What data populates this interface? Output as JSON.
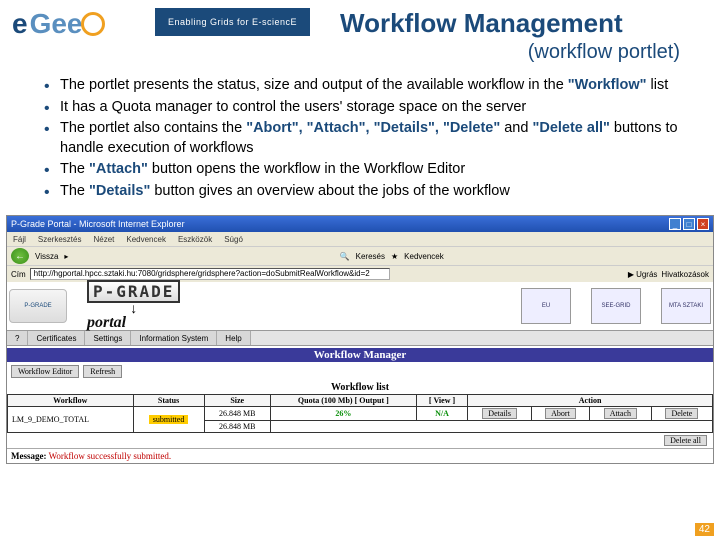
{
  "header": {
    "logo_text_e": "e",
    "logo_text_gee": "Gee",
    "tagline": "Enabling Grids for E-sciencE",
    "title": "Workflow Management",
    "subtitle": "(workflow portlet)"
  },
  "bullets": {
    "b1_pre": "The portlet presents the status, size and output of the available workflow in the ",
    "b1_wf": "\"Workflow\"",
    "b1_post": " list",
    "b2": "It has a Quota manager to control the users' storage space on the server",
    "b3_pre": "The portlet also contains the ",
    "b3_mid": "\"Abort\", \"Attach\", \"Details\", \"Delete\"",
    "b3_and": " and ",
    "b3_da": "\"Delete all\"",
    "b3_post": " buttons to handle execution of workflows",
    "b4_pre": "The ",
    "b4_att": "\"Attach\"",
    "b4_post": " button opens the workflow in the Workflow Editor",
    "b5_pre": "The ",
    "b5_det": "\"Details\"",
    "b5_post": " button gives an overview about the jobs of the workflow"
  },
  "ie": {
    "title": "P-Grade Portal - Microsoft Internet Explorer",
    "menu": {
      "m1": "Fájl",
      "m2": "Szerkesztés",
      "m3": "Nézet",
      "m4": "Kedvencek",
      "m5": "Eszközök",
      "m6": "Súgó"
    },
    "toolbar": {
      "back": "Vissza",
      "search": "Keresés",
      "fav": "Kedvencek"
    },
    "addr_label": "Cím",
    "address": "http://hgportal.hpcc.sztaki.hu:7080/gridsphere/gridsphere?action=doSubmitRealWorkflow&id=2",
    "go": "Ugrás",
    "links": "Hivatkozások"
  },
  "portal": {
    "pgrade_badge": "P-GRADE",
    "pgrade_text": "P-GRADE",
    "portal_word": "portal",
    "partner1": "EU",
    "partner2": "SEE-GRID",
    "partner3": "MTA SZTAKI",
    "tabs": {
      "t0": "?",
      "t1": "Certificates",
      "t2": "Settings",
      "t3": "Information System",
      "t4": "Help"
    }
  },
  "wm": {
    "banner": "Workflow Manager",
    "editor_btn": "Workflow Editor",
    "refresh_btn": "Refresh",
    "list_title": "Workflow list",
    "cols": {
      "c1": "Workflow",
      "c2": "Status",
      "c3": "Size",
      "c4": "Quota (100 Mb) [ Output ]",
      "c5": "[ View ]",
      "c6": "Action"
    },
    "row": {
      "name": "LM_9_DEMO_TOTAL",
      "status": "submitted",
      "size1": "26.848 MB",
      "quota": "26%",
      "output": "N/A",
      "details": "Details",
      "abort": "Abort",
      "attach": "Attach",
      "delete": "Delete"
    },
    "row2_size": "26.848 MB",
    "delete_all": "Delete all",
    "msg_label": "Message:",
    "msg_text": "Workflow successfully submitted."
  },
  "page_number": "42"
}
